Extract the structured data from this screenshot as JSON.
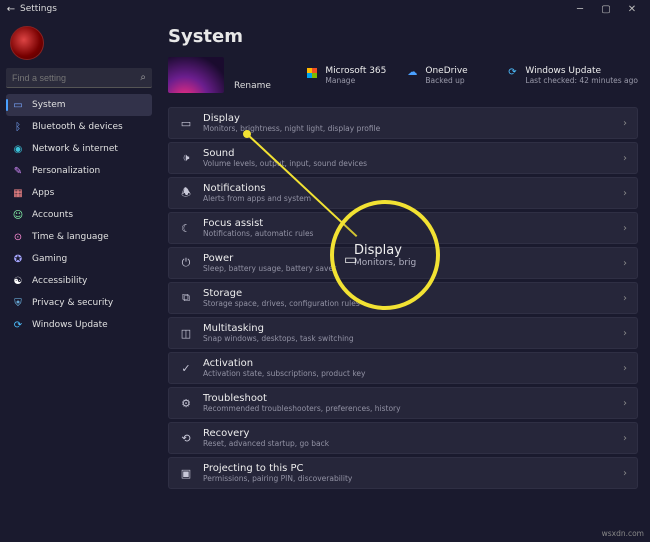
{
  "titlebar": {
    "title": "Settings"
  },
  "sidebar": {
    "search_placeholder": "Find a setting",
    "items": [
      {
        "label": "System"
      },
      {
        "label": "Bluetooth & devices"
      },
      {
        "label": "Network & internet"
      },
      {
        "label": "Personalization"
      },
      {
        "label": "Apps"
      },
      {
        "label": "Accounts"
      },
      {
        "label": "Time & language"
      },
      {
        "label": "Gaming"
      },
      {
        "label": "Accessibility"
      },
      {
        "label": "Privacy & security"
      },
      {
        "label": "Windows Update"
      }
    ]
  },
  "main": {
    "title": "System",
    "rename": "Rename",
    "status": {
      "ms365": {
        "title": "Microsoft 365",
        "sub": "Manage"
      },
      "onedrive": {
        "title": "OneDrive",
        "sub": "Backed up"
      },
      "winupdate": {
        "title": "Windows Update",
        "sub": "Last checked: 42 minutes ago"
      }
    },
    "rows": [
      {
        "title": "Display",
        "sub": "Monitors, brightness, night light, display profile"
      },
      {
        "title": "Sound",
        "sub": "Volume levels, output, input, sound devices"
      },
      {
        "title": "Notifications",
        "sub": "Alerts from apps and system"
      },
      {
        "title": "Focus assist",
        "sub": "Notifications, automatic rules"
      },
      {
        "title": "Power",
        "sub": "Sleep, battery usage, battery saver"
      },
      {
        "title": "Storage",
        "sub": "Storage space, drives, configuration rules"
      },
      {
        "title": "Multitasking",
        "sub": "Snap windows, desktops, task switching"
      },
      {
        "title": "Activation",
        "sub": "Activation state, subscriptions, product key"
      },
      {
        "title": "Troubleshoot",
        "sub": "Recommended troubleshooters, preferences, history"
      },
      {
        "title": "Recovery",
        "sub": "Reset, advanced startup, go back"
      },
      {
        "title": "Projecting to this PC",
        "sub": "Permissions, pairing PIN, discoverability"
      }
    ]
  },
  "highlight": {
    "title": "Display",
    "sub": "Monitors, brig"
  },
  "watermark": "wsxdn.com"
}
